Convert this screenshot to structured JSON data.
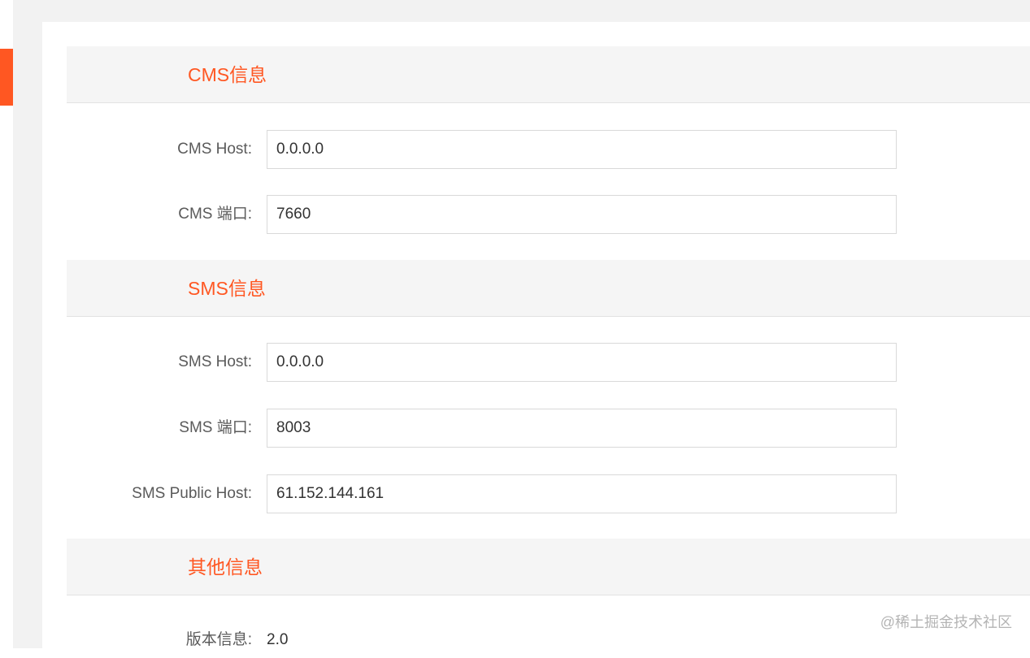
{
  "sections": {
    "cms": {
      "title": "CMS信息",
      "host_label": "CMS Host:",
      "host_value": "0.0.0.0",
      "port_label": "CMS 端口:",
      "port_value": "7660"
    },
    "sms": {
      "title": "SMS信息",
      "host_label": "SMS Host:",
      "host_value": "0.0.0.0",
      "port_label": "SMS 端口:",
      "port_value": "8003",
      "public_host_label": "SMS Public Host:",
      "public_host_value": "61.152.144.161"
    },
    "other": {
      "title": "其他信息",
      "version_label": "版本信息:",
      "version_value": "2.0"
    }
  },
  "watermark": "@稀土掘金技术社区",
  "colors": {
    "accent": "#ff5722",
    "header_bg": "#f5f5f5",
    "frame_bg": "#f2f2f2"
  }
}
